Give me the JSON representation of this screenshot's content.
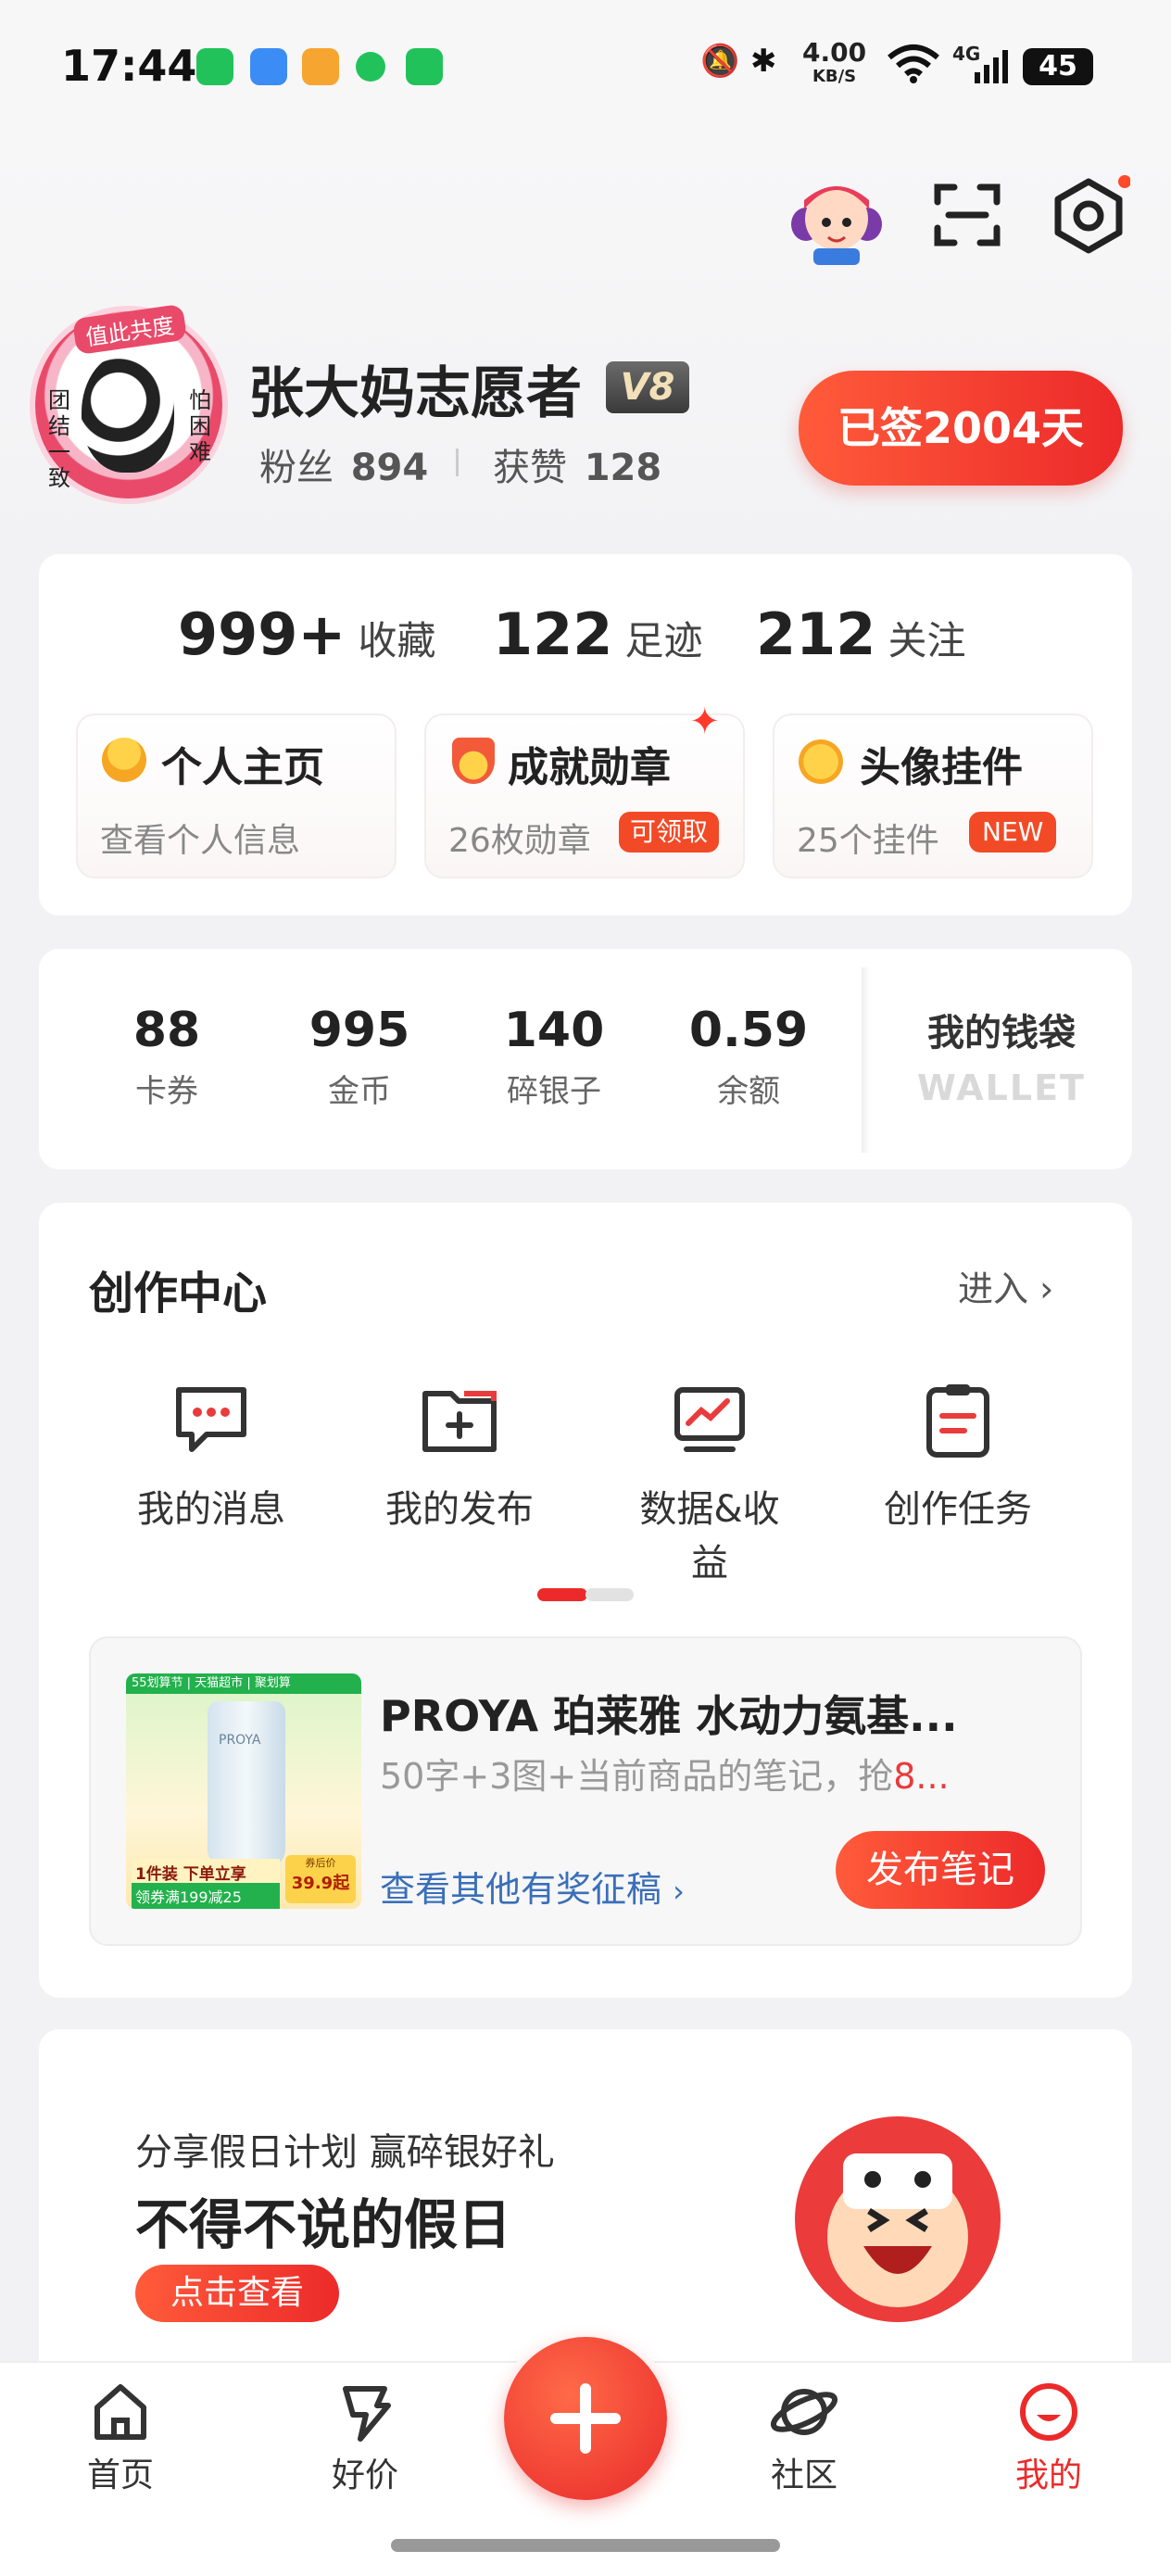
{
  "status_bar": {
    "time": "17:44",
    "speed_value": "4.00",
    "speed_unit": "KB/S",
    "network": "4G",
    "battery": "45",
    "app_icons": [
      "wechat-icon",
      "weather-icon",
      "notes-icon",
      "chat-icon",
      "phone-icon"
    ]
  },
  "header": {
    "mascot_icon": "mascot-avatar-icon",
    "scan_icon": "scan-icon",
    "settings_icon": "settings-icon"
  },
  "profile": {
    "username": "张大妈志愿者",
    "level": "V8",
    "fans_label": "粉丝",
    "fans_count": "894",
    "likes_label": "获赞",
    "likes_count": "128",
    "checkin_label": "已签2004天",
    "avatar_ribbon_top": "值此共度",
    "avatar_side_left": "团结一致",
    "avatar_side_right": "怕困难"
  },
  "stats": {
    "favorites_count": "999+",
    "favorites_label": "收藏",
    "footprints_count": "122",
    "footprints_label": "足迹",
    "following_count": "212",
    "following_label": "关注"
  },
  "quick_cards": [
    {
      "title": "个人主页",
      "subtitle": "查看个人信息",
      "badge": ""
    },
    {
      "title": "成就勋章",
      "subtitle": "26枚勋章",
      "badge": "可领取"
    },
    {
      "title": "头像挂件",
      "subtitle": "25个挂件",
      "badge": "NEW"
    }
  ],
  "wallet": {
    "items": [
      {
        "value": "88",
        "label": "卡券"
      },
      {
        "value": "995",
        "label": "金币"
      },
      {
        "value": "140",
        "label": "碎银子"
      },
      {
        "value": "0.59",
        "label": "余额"
      }
    ],
    "title": "我的钱袋",
    "subtitle": "WALLET"
  },
  "creation": {
    "title": "创作中心",
    "enter_label": "进入",
    "items": [
      {
        "label": "我的消息",
        "icon": "message-icon"
      },
      {
        "label": "我的发布",
        "icon": "publish-folder-icon"
      },
      {
        "label": "数据&收益",
        "icon": "data-chart-icon"
      },
      {
        "label": "创作任务",
        "icon": "task-clipboard-icon"
      }
    ],
    "page_indicator": {
      "pages": 2,
      "active": 0
    }
  },
  "promo": {
    "title": "PROYA 珀莱雅 水动力氨基...",
    "desc_prefix": "50字+3图+当前商品的笔记，抢",
    "desc_highlight": "8...",
    "link": "查看其他有奖征稿",
    "button": "发布笔记",
    "img_top": "55划算节 | 天猫超市 | 聚划算",
    "img_brand": "PROYA",
    "img_line1": "1件装 下单立享",
    "img_line2": "领券满199减25",
    "img_price_label": "券后价",
    "img_price": "39.9起"
  },
  "banner": {
    "subtitle": "分享假日计划 赢碎银好礼",
    "title": "不得不说的假日",
    "button": "点击查看"
  },
  "bottom_nav": {
    "items": [
      {
        "label": "首页",
        "icon": "home-icon",
        "active": false
      },
      {
        "label": "好价",
        "icon": "deal-icon",
        "active": false
      },
      {
        "label": "社区",
        "icon": "planet-icon",
        "active": false
      },
      {
        "label": "我的",
        "icon": "profile-icon",
        "active": true
      }
    ],
    "add_icon": "plus-icon"
  },
  "colors": {
    "accent": "#ec2a2a",
    "link": "#3a6fb8"
  }
}
